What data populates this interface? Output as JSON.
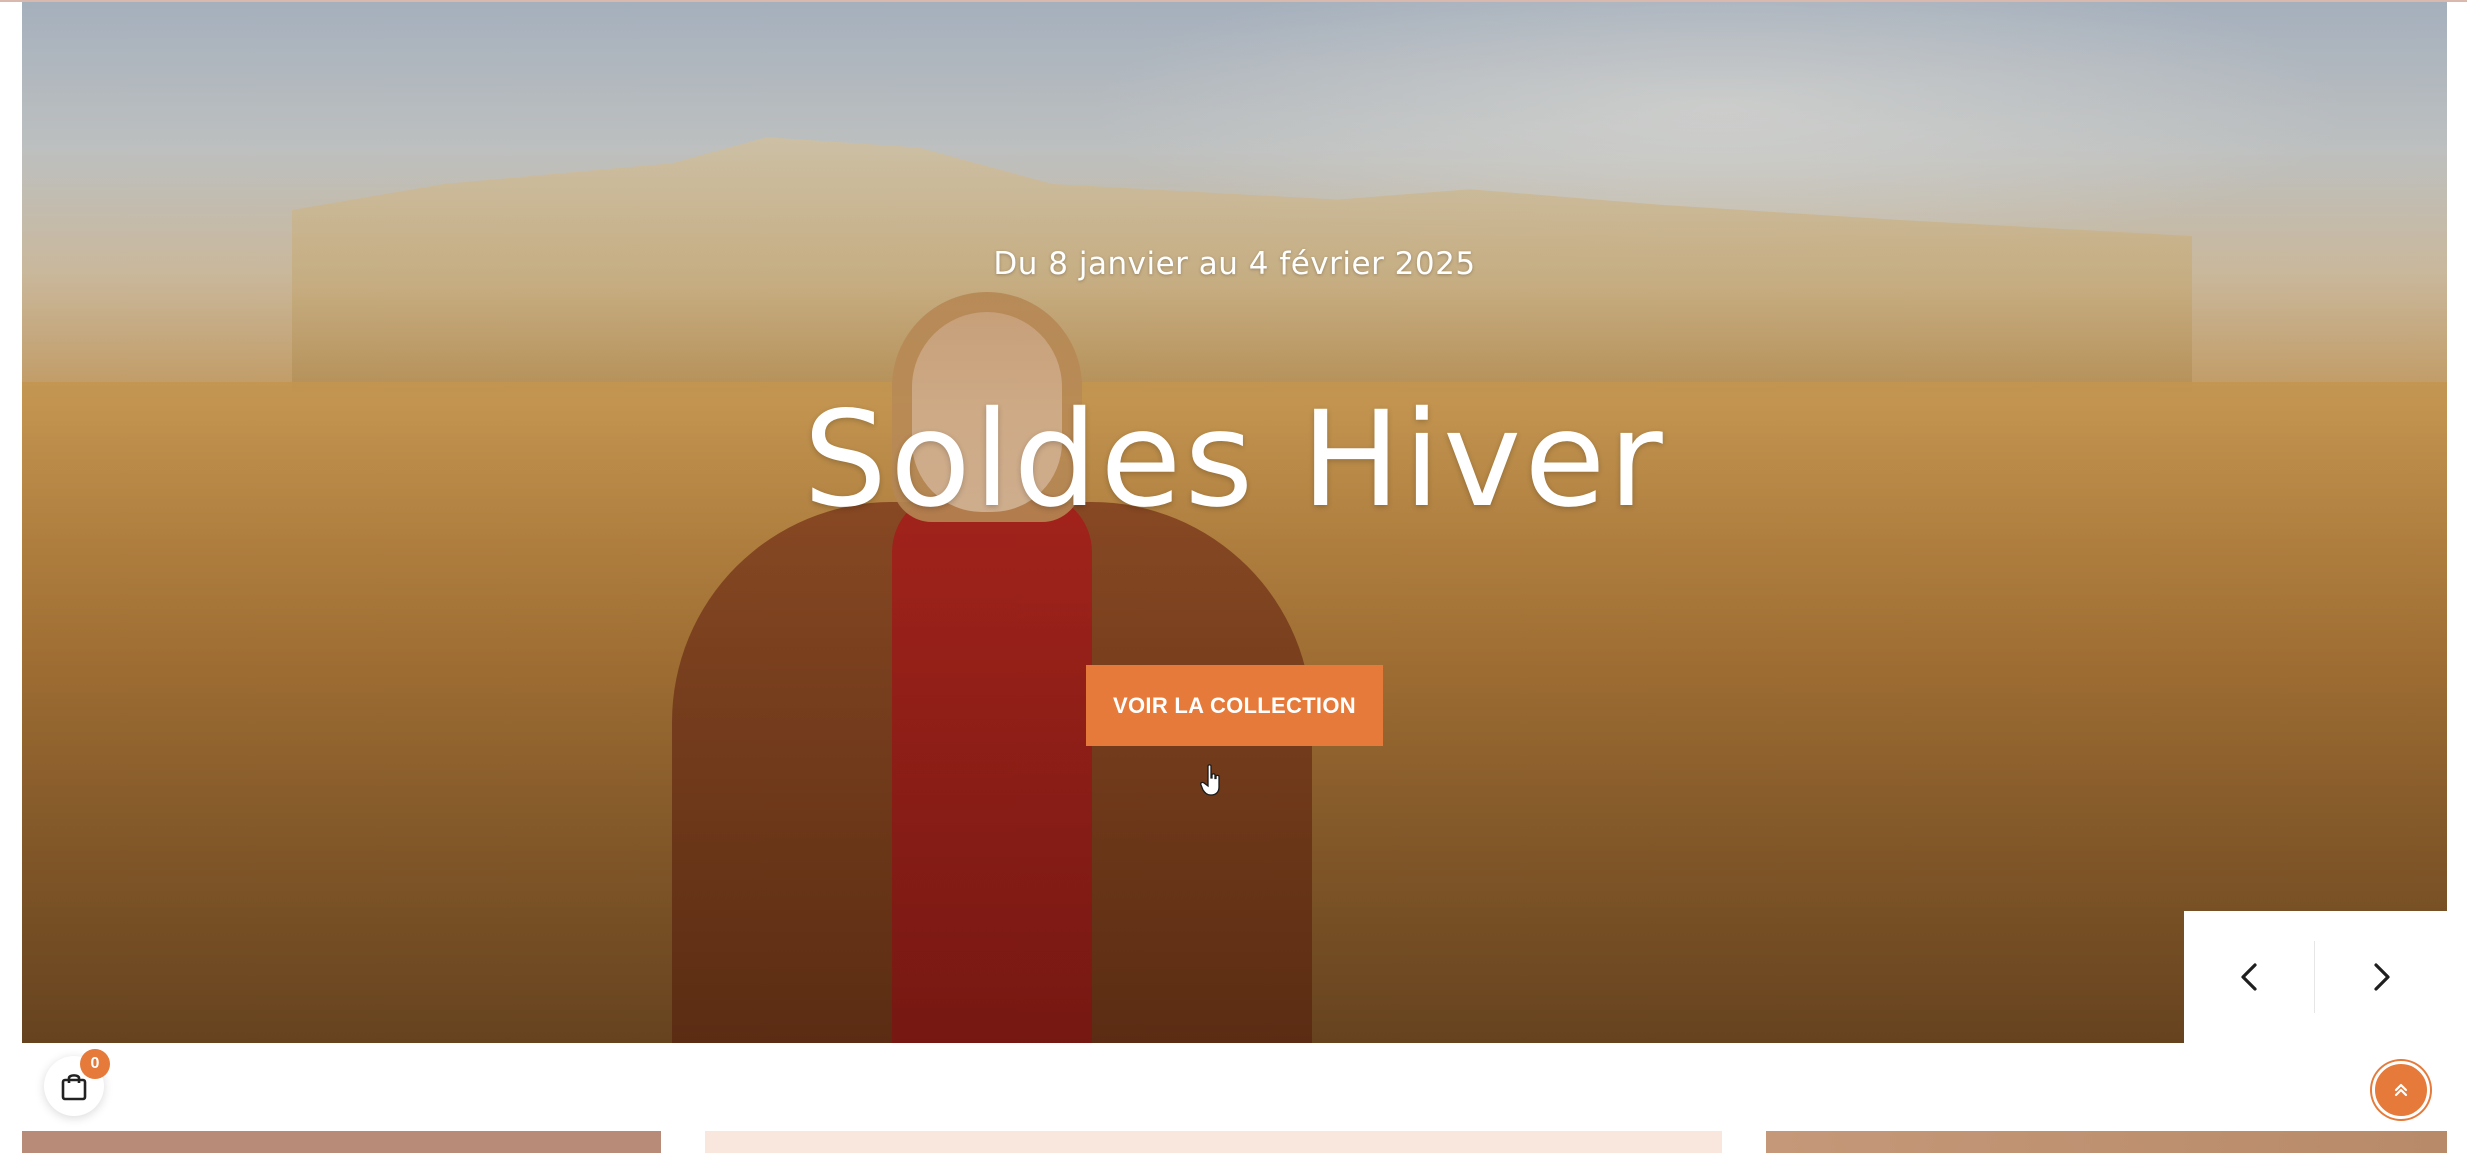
{
  "hero": {
    "subtitle": "Du 8 janvier au 4 février 2025",
    "title": "Soldes Hiver",
    "cta_label": "VOIR LA COLLECTION"
  },
  "slider": {
    "prev_icon": "chevron-left-icon",
    "next_icon": "chevron-right-icon"
  },
  "cart": {
    "icon": "shopping-bag-icon",
    "count": "0"
  },
  "back_to_top": {
    "icon": "double-chevron-up-icon"
  },
  "colors": {
    "accent": "#e57a3a",
    "white": "#ffffff"
  }
}
